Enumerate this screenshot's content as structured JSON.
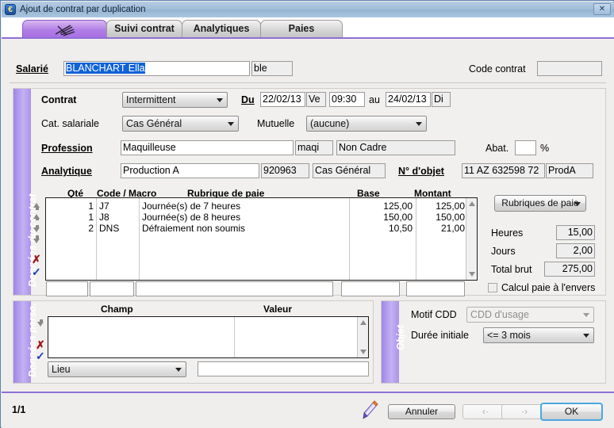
{
  "window": {
    "title": "Ajout de contrat par duplication",
    "app_icon": "euro-icon",
    "close_label": "✕"
  },
  "tabs": [
    {
      "label": "",
      "icon": "feather-icon",
      "active": true
    },
    {
      "label": "Suivi contrat",
      "active": false
    },
    {
      "label": "Analytiques",
      "active": false
    },
    {
      "label": "Paies",
      "active": false
    }
  ],
  "top": {
    "salarie_label": "Salarié",
    "salarie_value": "BLANCHART Ella",
    "salarie_code": "ble",
    "code_contrat_label": "Code contrat",
    "code_contrat_value": ""
  },
  "contract_panel": {
    "side_label": "Données du contrat",
    "contrat_label": "Contrat",
    "contrat_value": "Intermittent",
    "du_label": "Du",
    "du_date": "22/02/13",
    "du_day": "Ve",
    "du_time": "09:30",
    "au_label": "au",
    "au_date": "24/02/13",
    "au_day": "Di",
    "cat_label": "Cat. salariale",
    "cat_value": "Cas Général",
    "mutuelle_label": "Mutuelle",
    "mutuelle_value": "(aucune)",
    "profession_label": "Profession",
    "profession_value": "Maquilleuse",
    "profession_code": "maqi",
    "statut_value": "Non Cadre",
    "abat_label": "Abat.",
    "abat_value": "",
    "abat_unit": "%",
    "analytique_label": "Analytique",
    "analytique_value": "Production A",
    "analytique_code": "920963",
    "analytique_cat": "Cas Général",
    "objet_label": "N° d'objet",
    "objet_value": "11 AZ 632598 72",
    "objet_code": "ProdA"
  },
  "grid": {
    "headers": [
      "Qté",
      "Code / Macro",
      "Rubrique de paie",
      "Base",
      "Montant"
    ],
    "rows": [
      {
        "qte": "1",
        "code": "J7",
        "rubrique": "Journée(s) de 7 heures",
        "base": "125,00",
        "montant": "125,00"
      },
      {
        "qte": "1",
        "code": "J8",
        "rubrique": "Journée(s) de 8 heures",
        "base": "150,00",
        "montant": "150,00"
      },
      {
        "qte": "2",
        "code": "DNS",
        "rubrique": "Défraiement non soumis",
        "base": "10,50",
        "montant": "21,00"
      }
    ],
    "entry": {
      "qte": "",
      "code": "",
      "rubrique": "",
      "base": "",
      "montant": ""
    },
    "row_tools": [
      "move-top-icon",
      "move-up-icon",
      "move-down-icon",
      "move-bottom-icon",
      "delete-icon",
      "validate-icon"
    ]
  },
  "totals": {
    "button_label": "Rubriques de paie",
    "heures_label": "Heures",
    "heures_value": "15,00",
    "jours_label": "Jours",
    "jours_value": "2,00",
    "total_label": "Total brut",
    "total_value": "275,00",
    "checkbox_label": "Calcul paie à l'envers",
    "checkbox_checked": false
  },
  "perso": {
    "side_label": "Données perso.",
    "col_champ": "Champ",
    "col_valeur": "Valeur",
    "rows": [],
    "entry_field": "Lieu",
    "entry_value": ""
  },
  "objet": {
    "side_label": "Objet",
    "motif_label": "Motif CDD",
    "motif_value": "CDD d'usage",
    "motif_disabled": true,
    "duree_label": "Durée initiale",
    "duree_value": "<= 3 mois"
  },
  "footer": {
    "page_indicator": "1/1",
    "pen_icon": "pencil-icon",
    "cancel_label": "Annuler",
    "prev_label": "‹·",
    "next_label": "·›",
    "ok_label": "OK"
  },
  "colors": {
    "accent_purple": "#8e6fd6",
    "tab_active": "#a96ee2",
    "selection_blue": "#1063d6",
    "delete_red": "#9b1414",
    "validate_blue": "#1a3bb8"
  }
}
